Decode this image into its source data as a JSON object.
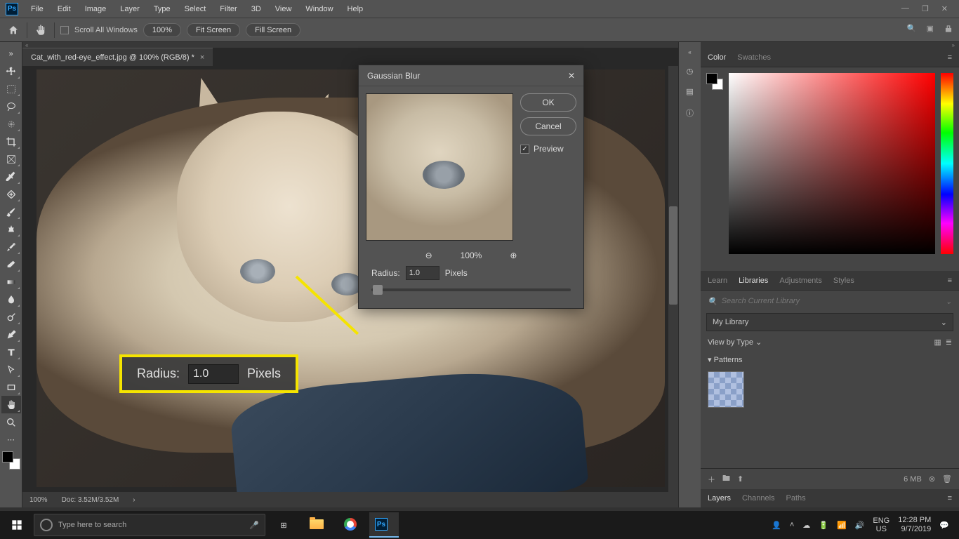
{
  "menubar": {
    "items": [
      "File",
      "Edit",
      "Image",
      "Layer",
      "Type",
      "Select",
      "Filter",
      "3D",
      "View",
      "Window",
      "Help"
    ]
  },
  "options_bar": {
    "scroll_all_label": "Scroll All Windows",
    "zoom_label": "100%",
    "fit_screen": "Fit Screen",
    "fill_screen": "Fill Screen"
  },
  "document": {
    "tab_title": "Cat_with_red-eye_effect.jpg @ 100% (RGB/8) *",
    "status_zoom": "100%",
    "status_doc": "Doc: 3.52M/3.52M"
  },
  "dialog": {
    "title": "Gaussian Blur",
    "ok": "OK",
    "cancel": "Cancel",
    "preview_label": "Preview",
    "preview_checked": true,
    "zoom_value": "100%",
    "radius_label": "Radius:",
    "radius_value": "1.0",
    "radius_unit": "Pixels"
  },
  "callout": {
    "label": "Radius:",
    "value": "1.0",
    "unit": "Pixels"
  },
  "panels": {
    "color_tabs": [
      "Color",
      "Swatches"
    ],
    "lib_tabs": [
      "Learn",
      "Libraries",
      "Adjustments",
      "Styles"
    ],
    "lib_search_placeholder": "Search Current Library",
    "lib_selected": "My Library",
    "lib_view_label": "View by Type",
    "lib_section": "Patterns",
    "lib_size": "6 MB",
    "layer_tabs": [
      "Layers",
      "Channels",
      "Paths"
    ]
  },
  "taskbar": {
    "search_placeholder": "Type here to search",
    "lang1": "ENG",
    "lang2": "US",
    "time": "12:28 PM",
    "date": "9/7/2019"
  },
  "tools": [
    "move",
    "marquee",
    "lasso",
    "quick-select",
    "crop",
    "frame",
    "eyedropper",
    "healing",
    "brush",
    "clone",
    "history-brush",
    "eraser",
    "gradient",
    "blur",
    "dodge",
    "pen",
    "type",
    "path-select",
    "rectangle",
    "hand",
    "zoom",
    "edit-toolbar"
  ]
}
